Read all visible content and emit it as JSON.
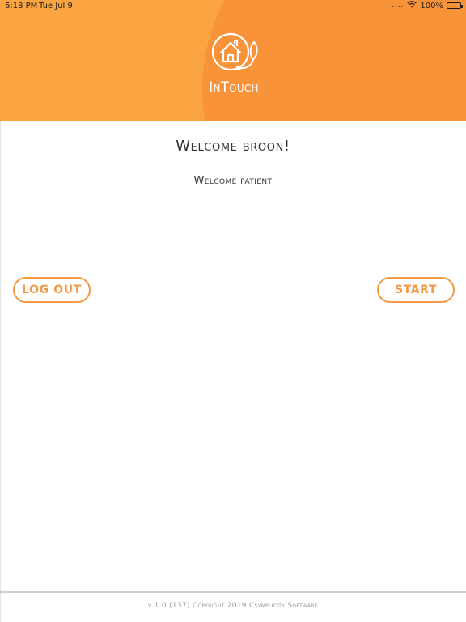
{
  "status_bar": {
    "time": "6:18 PM",
    "date": "Tue Jul 9",
    "signal_dots": "....",
    "battery_percent": "100%"
  },
  "header": {
    "app_name": "InTouch",
    "logo_icon": "house-with-stethoscope-icon",
    "colors": {
      "background": "#faa541",
      "accent_arc": "#f8933a"
    }
  },
  "main": {
    "welcome_title": "Welcome broon!",
    "welcome_subtitle": "Welcome patient",
    "logout_label": "LOG OUT",
    "start_label": "START",
    "button_color": "#f29a45"
  },
  "footer": {
    "text": "v 1.0 (137) Copyright 2019 Csymplicity Software"
  }
}
